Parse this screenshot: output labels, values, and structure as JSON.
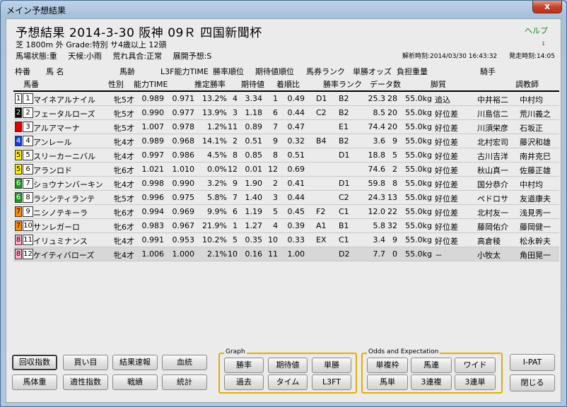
{
  "window": {
    "title": "メイン予想結果",
    "close": "x"
  },
  "header": {
    "race_title": "予想結果 2014-3-30 阪神 09Ｒ 四国新聞杯",
    "help": "ヘルプ",
    "tiny": "ｪ",
    "line2": "芝 1800m 外  Grade:特別 サ4歳以上  12頭",
    "line3": [
      "馬場状態:重",
      "天候:小雨",
      "荒れ具合:正常",
      "展開予想:S"
    ],
    "analysis_time": "解析時刻:2014/03/30 16:43:32",
    "post_time": "発走時刻:14:05"
  },
  "columns": {
    "top": [
      "枠番",
      "馬  名",
      "馬齢",
      "L3F能力TIME",
      "勝率順位",
      "期待値順位",
      "馬券ランク",
      "単勝オッズ",
      "負担重量",
      "騎手"
    ],
    "bottom": [
      "馬番",
      "性別",
      "能力TIME",
      "推定勝率",
      "期待値",
      "着順比",
      "勝率ランク",
      "データ数",
      "脚質",
      "調教師"
    ]
  },
  "horses": [
    {
      "waku": "1",
      "waku_bg": "#ffffff",
      "waku_fg": "#000000",
      "ban": "1",
      "name": "マイネアルナイル",
      "sex": "牝",
      "age": "5才",
      "time": "0.989",
      "l3f": "0.971",
      "rate": "13.2%",
      "rrank": "4",
      "exp": "3.34",
      "erank": "1",
      "chaku": "0.49",
      "baken": "D1",
      "wrank": "B2",
      "odds": "25.3",
      "count": "28",
      "weight": "55.0kg",
      "kyaku": "追込",
      "jockey": "中井裕二",
      "trainer": "中村均"
    },
    {
      "waku": "2",
      "waku_bg": "#000000",
      "waku_fg": "#ffffff",
      "ban": "2",
      "name": "フェータルローズ",
      "sex": "牝",
      "age": "5才",
      "time": "0.990",
      "l3f": "0.977",
      "rate": "13.9%",
      "rrank": "3",
      "exp": "1.18",
      "erank": "6",
      "chaku": "0.44",
      "baken": "C2",
      "wrank": "B2",
      "odds": "8.5",
      "count": "20",
      "weight": "55.0kg",
      "kyaku": "好位差",
      "jockey": "川島信二",
      "trainer": "荒川義之"
    },
    {
      "waku": "",
      "waku_bg": "#e00000",
      "waku_fg": "#ffffff",
      "ban": "3",
      "name": "アルアマーナ",
      "sex": "牝",
      "age": "5才",
      "time": "1.007",
      "l3f": "0.978",
      "rate": "1.2%",
      "rrank": "11",
      "exp": "0.89",
      "erank": "7",
      "chaku": "0.47",
      "baken": "",
      "wrank": "E1",
      "odds": "74.4",
      "count": "20",
      "weight": "55.0kg",
      "kyaku": "好位差",
      "jockey": "川須栄彦",
      "trainer": "石坂正"
    },
    {
      "waku": "4",
      "waku_bg": "#1a3ad8",
      "waku_fg": "#ffffff",
      "ban": "4",
      "name": "アンレール",
      "sex": "牝",
      "age": "4才",
      "time": "0.989",
      "l3f": "0.968",
      "rate": "14.1%",
      "rrank": "2",
      "exp": "0.51",
      "erank": "9",
      "chaku": "0.32",
      "baken": "B4",
      "wrank": "B2",
      "odds": "3.6",
      "count": "9",
      "weight": "55.0kg",
      "kyaku": "好位差",
      "jockey": "北村宏司",
      "trainer": "藤沢和雄"
    },
    {
      "waku": "5",
      "waku_bg": "#ffee00",
      "waku_fg": "#000000",
      "ban": "5",
      "name": "スリーカーニバル",
      "sex": "牝",
      "age": "4才",
      "time": "0.997",
      "l3f": "0.986",
      "rate": "4.5%",
      "rrank": "8",
      "exp": "0.85",
      "erank": "8",
      "chaku": "0.51",
      "baken": "",
      "wrank": "D1",
      "odds": "18.8",
      "count": "5",
      "weight": "55.0kg",
      "kyaku": "好位差",
      "jockey": "古川吉洋",
      "trainer": "南井克巳"
    },
    {
      "waku": "5",
      "waku_bg": "#ffee00",
      "waku_fg": "#000000",
      "ban": "6",
      "name": "アランロド",
      "sex": "牝",
      "age": "6才",
      "time": "1.021",
      "l3f": "1.010",
      "rate": "0.0%",
      "rrank": "12",
      "exp": "0.01",
      "erank": "12",
      "chaku": "0.69",
      "baken": "",
      "wrank": "",
      "odds": "74.6",
      "count": "2",
      "weight": "55.0kg",
      "kyaku": "好位差",
      "jockey": "秋山真一",
      "trainer": "佐藤正雄"
    },
    {
      "waku": "6",
      "waku_bg": "#1a9a1a",
      "waku_fg": "#ffffff",
      "ban": "7",
      "name": "ショウナンバーキン",
      "sex": "牝",
      "age": "4才",
      "time": "0.998",
      "l3f": "0.990",
      "rate": "3.2%",
      "rrank": "9",
      "exp": "1.90",
      "erank": "2",
      "chaku": "0.41",
      "baken": "",
      "wrank": "D1",
      "odds": "59.8",
      "count": "8",
      "weight": "55.0kg",
      "kyaku": "好位差",
      "jockey": "国分恭介",
      "trainer": "中村均"
    },
    {
      "waku": "6",
      "waku_bg": "#1a9a1a",
      "waku_fg": "#ffffff",
      "ban": "8",
      "name": "ラシンティランテ",
      "sex": "牝",
      "age": "5才",
      "time": "0.996",
      "l3f": "0.975",
      "rate": "5.8%",
      "rrank": "7",
      "exp": "1.40",
      "erank": "3",
      "chaku": "0.44",
      "baken": "",
      "wrank": "C2",
      "odds": "24.3",
      "count": "13",
      "weight": "55.0kg",
      "kyaku": "好位差",
      "jockey": "ペドロサ",
      "trainer": "友道康夫"
    },
    {
      "waku": "7",
      "waku_bg": "#ff8c00",
      "waku_fg": "#000000",
      "ban": "9",
      "name": "ニシノテキーラ",
      "sex": "牝",
      "age": "6才",
      "time": "0.994",
      "l3f": "0.969",
      "rate": "9.9%",
      "rrank": "6",
      "exp": "1.19",
      "erank": "5",
      "chaku": "0.45",
      "baken": "F2",
      "wrank": "C1",
      "odds": "12.0",
      "count": "22",
      "weight": "55.0kg",
      "kyaku": "好位差",
      "jockey": "北村友一",
      "trainer": "浅見秀一"
    },
    {
      "waku": "7",
      "waku_bg": "#ff8c00",
      "waku_fg": "#000000",
      "ban": "10",
      "name": "サンレガーロ",
      "sex": "牝",
      "age": "6才",
      "time": "0.983",
      "l3f": "0.967",
      "rate": "21.9%",
      "rrank": "1",
      "exp": "1.27",
      "erank": "4",
      "chaku": "0.39",
      "baken": "A1",
      "wrank": "B1",
      "odds": "5.8",
      "count": "32",
      "weight": "55.0kg",
      "kyaku": "好位差",
      "jockey": "藤岡佑介",
      "trainer": "藤岡健一"
    },
    {
      "waku": "8",
      "waku_bg": "#ffb0c8",
      "waku_fg": "#000000",
      "ban": "11",
      "name": "イリュミナンス",
      "sex": "牝",
      "age": "4才",
      "time": "0.991",
      "l3f": "0.953",
      "rate": "10.2%",
      "rrank": "5",
      "exp": "0.35",
      "erank": "10",
      "chaku": "0.33",
      "baken": "EX",
      "wrank": "C1",
      "odds": "3.4",
      "count": "9",
      "weight": "55.0kg",
      "kyaku": "好位差",
      "jockey": "高倉稜",
      "trainer": "松永幹夫"
    },
    {
      "waku": "8",
      "waku_bg": "#ffb0c8",
      "waku_fg": "#000000",
      "ban": "12",
      "name": "ケイティバローズ",
      "sex": "牝",
      "age": "4才",
      "time": "1.006",
      "l3f": "1.000",
      "rate": "2.1%",
      "rrank": "10",
      "exp": "0.16",
      "erank": "11",
      "chaku": "1.00",
      "baken": "",
      "wrank": "D2",
      "odds": "7.7",
      "count": "0",
      "weight": "55.0kg",
      "kyaku": "－",
      "jockey": "小牧太",
      "trainer": "角田晃一"
    }
  ],
  "buttons": {
    "kaishu": "回収指数",
    "kaime": "買い目",
    "kekka": "結果速報",
    "ketto": "血統",
    "bataiju": "馬体重",
    "tekisei": "適性指数",
    "senseki": "戦績",
    "tokei": "統計",
    "graph_label": "Graph",
    "shoritsu": "勝率",
    "kitaichi": "期待値",
    "tansho": "単勝",
    "kako": "過去",
    "time": "タイム",
    "l3ft": "L3FT",
    "odds_label": "Odds and Expectation",
    "fukusho": "単複枠",
    "umaren": "馬連",
    "wide": "ワイド",
    "umatan": "馬単",
    "sanrenpuku": "3連複",
    "sanrentan": "3連単",
    "ipat": "I-PAT",
    "close": "閉じる"
  }
}
